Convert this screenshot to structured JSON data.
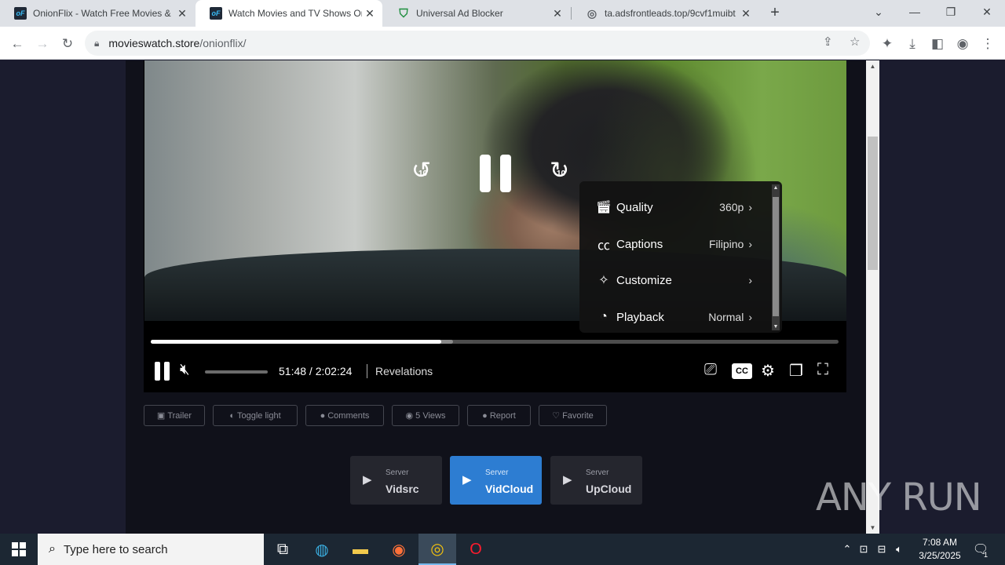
{
  "browser": {
    "tabs": [
      {
        "title": "OnionFlix - Watch Free Movies &",
        "favicon": "onionflix-icon",
        "active": false
      },
      {
        "title": "Watch Movies and TV Shows On",
        "favicon": "onionflix-icon",
        "active": true
      },
      {
        "title": "Universal Ad Blocker",
        "favicon": "shield-icon",
        "active": false
      },
      {
        "title": "ta.adsfrontleads.top/9cvf1muibt",
        "favicon": "globe-icon",
        "active": false
      }
    ],
    "url_host": "movieswatch.store",
    "url_path": "/onionflix/"
  },
  "player": {
    "current_time": "51:48",
    "duration": "2:02:24",
    "time_display": "51:48 / 2:02:24",
    "episode_title": "Revelations",
    "progress_played": 0.422,
    "progress_buffered": 0.44,
    "volume": 0,
    "skip_back_label": "10",
    "skip_forward_label": "10",
    "cc_label": "CC",
    "settings_menu": [
      {
        "label": "Quality",
        "value": "360p",
        "icon": "clapperboard-icon"
      },
      {
        "label": "Captions",
        "value": "Filipino",
        "icon": "cc-icon"
      },
      {
        "label": "Customize",
        "value": "",
        "icon": "magic-wand-icon"
      },
      {
        "label": "Playback",
        "value": "Normal",
        "icon": "clock-icon"
      }
    ]
  },
  "actions": [
    {
      "label": "Trailer",
      "icon": "video-icon"
    },
    {
      "label": "Toggle light",
      "icon": "adjust-icon"
    },
    {
      "label": "Comments",
      "icon": "comment-icon"
    },
    {
      "label": "5 Views",
      "icon": "eye-icon"
    },
    {
      "label": "Report",
      "icon": "warning-icon"
    },
    {
      "label": "Favorite",
      "icon": "heart-icon"
    }
  ],
  "servers": [
    {
      "caption": "Server",
      "name": "Vidsrc",
      "active": false
    },
    {
      "caption": "Server",
      "name": "VidCloud",
      "active": true
    },
    {
      "caption": "Server",
      "name": "UpCloud",
      "active": false
    }
  ],
  "watermark": "ANY RUN",
  "taskbar": {
    "search_placeholder": "Type here to search",
    "time": "7:08 AM",
    "date": "3/25/2025",
    "notification_count": "1"
  }
}
